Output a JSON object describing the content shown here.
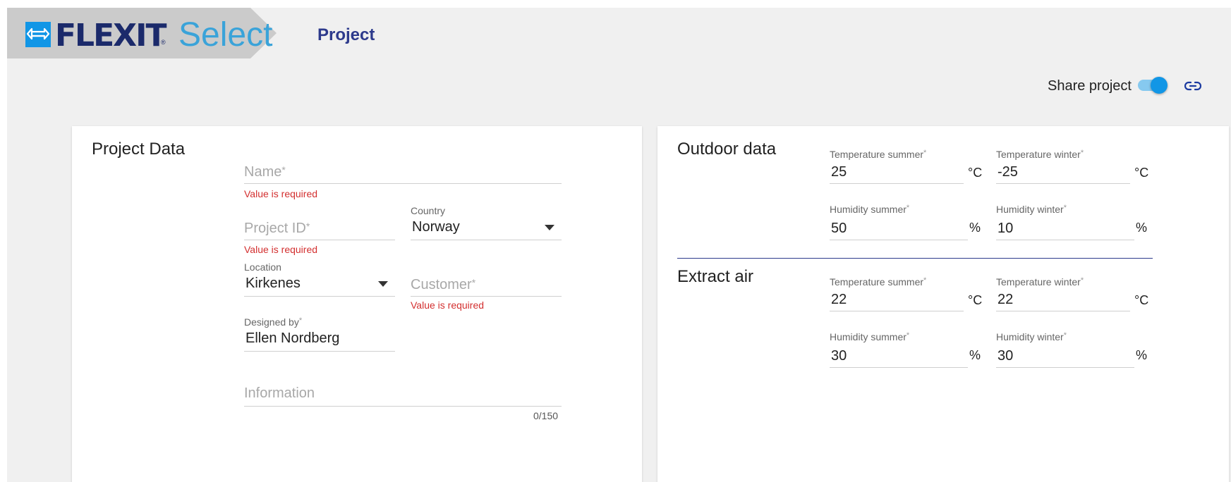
{
  "header": {
    "logo_text": "FLEXIT",
    "logo_registered": "®",
    "logo_product": "Select",
    "page_title": "Project"
  },
  "share": {
    "label": "Share project",
    "enabled": true
  },
  "project_data": {
    "title": "Project Data",
    "name": {
      "placeholder": "Name",
      "required_mark": "*",
      "error": "Value is required"
    },
    "project_id": {
      "placeholder": "Project ID",
      "required_mark": "*",
      "error": "Value is required"
    },
    "country": {
      "label": "Country",
      "value": "Norway"
    },
    "location": {
      "label": "Location",
      "value": "Kirkenes"
    },
    "customer": {
      "placeholder": "Customer",
      "required_mark": "*",
      "error": "Value is required"
    },
    "designed_by": {
      "label": "Designed by",
      "required_mark": "*",
      "value": "Ellen Nordberg"
    },
    "information": {
      "placeholder": "Information",
      "counter": "0/150"
    }
  },
  "outdoor_data": {
    "title": "Outdoor data",
    "temp_summer": {
      "label": "Temperature summer",
      "required_mark": "*",
      "value": "25",
      "unit": "°C"
    },
    "temp_winter": {
      "label": "Temperature winter",
      "required_mark": "*",
      "value": "-25",
      "unit": "°C"
    },
    "hum_summer": {
      "label": "Humidity summer",
      "required_mark": "*",
      "value": "50",
      "unit": "%"
    },
    "hum_winter": {
      "label": "Humidity winter",
      "required_mark": "*",
      "value": "10",
      "unit": "%"
    }
  },
  "extract_air": {
    "title": "Extract air",
    "temp_summer": {
      "label": "Temperature summer",
      "required_mark": "*",
      "value": "22",
      "unit": "°C"
    },
    "temp_winter": {
      "label": "Temperature winter",
      "required_mark": "*",
      "value": "22",
      "unit": "°C"
    },
    "hum_summer": {
      "label": "Humidity summer",
      "required_mark": "*",
      "value": "30",
      "unit": "%"
    },
    "hum_winter": {
      "label": "Humidity winter",
      "required_mark": "*",
      "value": "30",
      "unit": "%"
    }
  },
  "colors": {
    "brand_navy": "#1b2a6b",
    "brand_blue": "#3aa3d9",
    "error": "#d32f2f",
    "toggle_on": "#1196e6"
  }
}
